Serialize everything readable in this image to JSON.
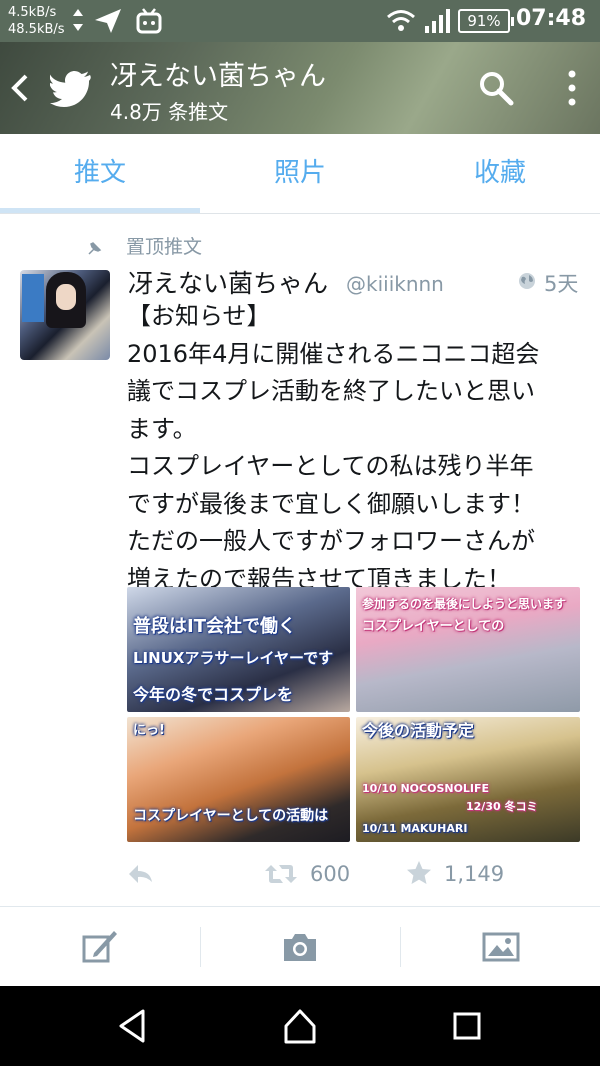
{
  "status_bar": {
    "speed_up": "4.5kB/s",
    "speed_down": "48.5kB/s",
    "battery": "91%",
    "time": "07:48"
  },
  "header": {
    "title": "冴えない菌ちゃん",
    "subtitle": "4.8万 条推文"
  },
  "tabs": [
    {
      "label": "推文",
      "active": true
    },
    {
      "label": "照片",
      "active": false
    },
    {
      "label": "收藏",
      "active": false
    }
  ],
  "tweet": {
    "pinned_label": "置顶推文",
    "author": "冴えない菌ちゃん",
    "handle": "@kiiiknnn",
    "age": "5天",
    "text_lines": [
      "【お知らせ】",
      "2016年4月に開催されるニコニコ超会",
      "議でコスプレ活動を終了したいと思い",
      "ます。",
      "コスプレイヤーとしての私は残り半年",
      "ですが最後まで宜しく御願いします！",
      "ただの一般人ですがフォロワーさんが",
      "増えたので報告させて頂きました！"
    ],
    "media": [
      {
        "lines": [
          "普段はIT会社で働く",
          "LINUXアラサーレイヤーです",
          "今年の冬でコスプレを"
        ]
      },
      {
        "lines": [
          "参加するのを最後にしようと思います",
          "コスプレイヤーとしての"
        ]
      },
      {
        "lines": [
          "にっ!",
          "コスプレイヤーとしての活動は"
        ]
      },
      {
        "lines": [
          "今後の活動予定",
          "10/10 NOCOSNOLIFE",
          "12/30 冬コミ",
          "10/11 MAKUHARI"
        ]
      }
    ],
    "retweets": "600",
    "favorites": "1,149"
  },
  "colors": {
    "accent": "#55acee",
    "muted": "#8899a6",
    "text": "#14171a"
  },
  "icons": {
    "back": "chevron-left-icon",
    "logo": "twitter-bird-icon",
    "search": "search-icon",
    "more": "more-vertical-icon",
    "pin": "pin-icon",
    "globe": "globe-icon",
    "reply": "reply-icon",
    "retweet": "retweet-icon",
    "favorite": "star-icon",
    "compose": "compose-icon",
    "camera": "camera-icon",
    "gallery": "image-icon",
    "nav_back": "nav-back-icon",
    "nav_home": "nav-home-icon",
    "nav_recents": "nav-recents-icon"
  }
}
